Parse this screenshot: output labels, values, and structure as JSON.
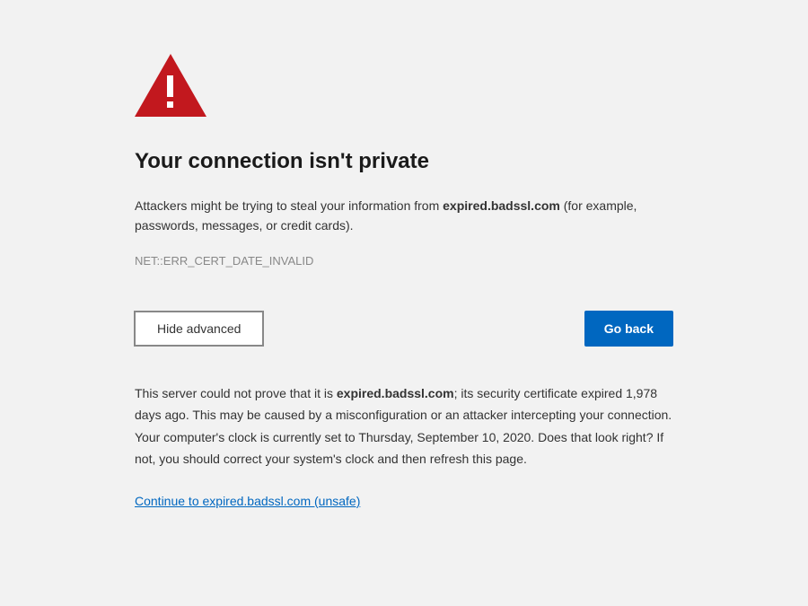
{
  "colors": {
    "danger": "#c2181e",
    "primary": "#0067c0"
  },
  "warning": {
    "heading": "Your connection isn't private",
    "subtitle_pre": "Attackers might be trying to steal your information from ",
    "subtitle_host": "expired.badssl.com",
    "subtitle_post": " (for example, passwords, messages, or credit cards).",
    "error_code": "NET::ERR_CERT_DATE_INVALID"
  },
  "buttons": {
    "hide_advanced": "Hide advanced",
    "go_back": "Go back"
  },
  "details": {
    "pre": "This server could not prove that it is ",
    "host": "expired.badssl.com",
    "post": "; its security certificate expired 1,978 days ago. This may be caused by a misconfiguration or an attacker intercepting your connection. Your computer's clock is currently set to Thursday, September 10, 2020. Does that look right? If not, you should correct your system's clock and then refresh this page."
  },
  "continue_link": "Continue to expired.badssl.com (unsafe)"
}
